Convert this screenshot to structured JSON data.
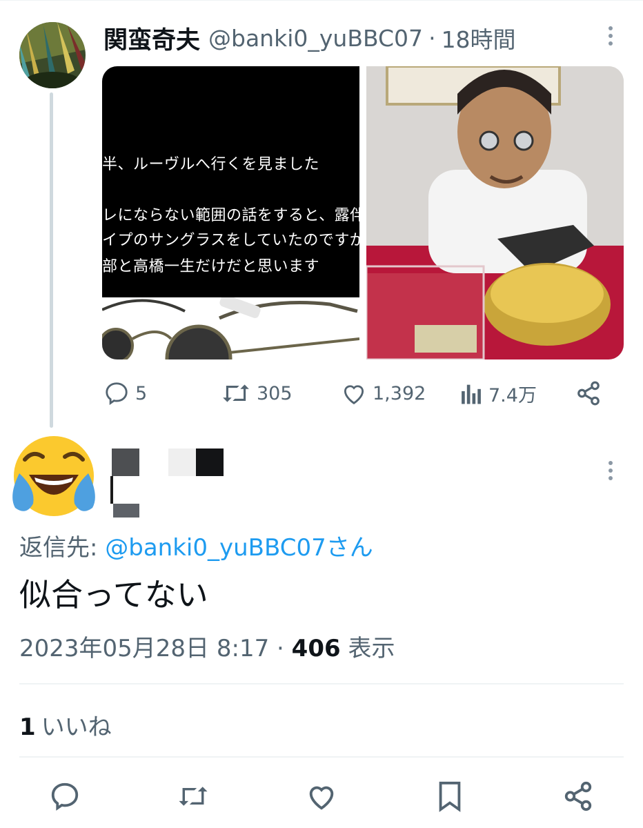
{
  "parent": {
    "name": "関蛮奇夫",
    "handle": "@banki0_yuBBC07",
    "separator": "·",
    "time": "18時間",
    "image_left": {
      "lines": [
        "半、ルーヴルへ行くを見ました",
        "レにならない範囲の話をすると、露伴",
        "イプのサングラスをしていたのですが",
        "部と高橋一生だけだと思います"
      ]
    },
    "stats": {
      "replies": "5",
      "retweets": "305",
      "likes": "1,392",
      "views": "7.4万"
    }
  },
  "reply": {
    "reply_to_prefix": "返信先: ",
    "reply_to_mention": "@banki0_yuBBC07さん",
    "text": "似合ってない",
    "date": "2023年05月28日 8:17",
    "separator": " · ",
    "views_count": "406",
    "views_label": " 表示",
    "likes_count": "1",
    "likes_label": "いいね"
  },
  "colors": {
    "accent": "#1d9bf0",
    "secondary_text": "#536471",
    "primary_text": "#0f1419",
    "divider": "#eff3f4"
  },
  "icons": {
    "reply": "reply-icon",
    "retweet": "retweet-icon",
    "like": "heart-icon",
    "views": "analytics-icon",
    "share": "share-icon",
    "bookmark": "bookmark-icon",
    "more": "more-icon",
    "emoji": "face-with-tears-of-joy-emoji"
  }
}
